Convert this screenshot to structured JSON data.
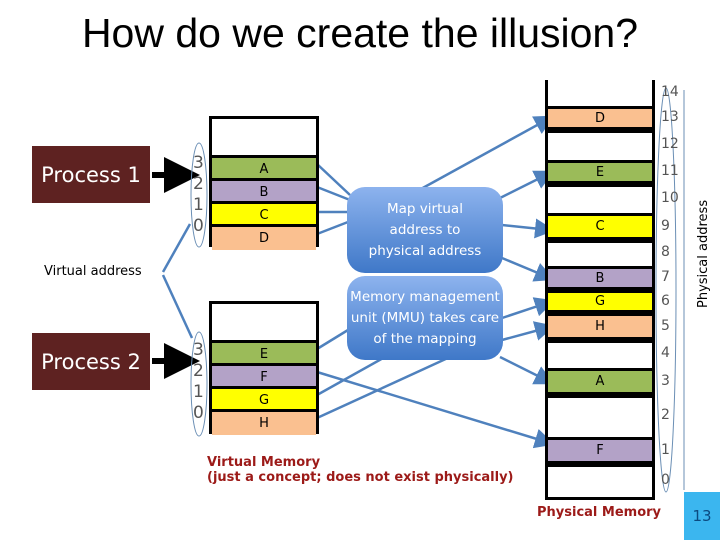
{
  "title": "How do we create the illusion?",
  "processes": [
    {
      "label": "Process 1"
    },
    {
      "label": "Process 2"
    }
  ],
  "virtual_address_label": "Virtual address",
  "virtual_addresses": [
    "3",
    "2",
    "1",
    "0"
  ],
  "virtual_memory": {
    "process1": [
      {
        "label": "",
        "color": "#ffffff"
      },
      {
        "label": "A",
        "color": "#9bbb59"
      },
      {
        "label": "B",
        "color": "#b3a2c7"
      },
      {
        "label": "C",
        "color": "#ffff00"
      },
      {
        "label": "D",
        "color": "#fac090"
      }
    ],
    "process2": [
      {
        "label": "",
        "color": "#ffffff"
      },
      {
        "label": "E",
        "color": "#9bbb59"
      },
      {
        "label": "F",
        "color": "#b3a2c7"
      },
      {
        "label": "G",
        "color": "#ffff00"
      },
      {
        "label": "H",
        "color": "#fac090"
      }
    ]
  },
  "mmu": {
    "box1": "Map virtual address to physical address",
    "box2": "Memory management unit (MMU) takes care of the mapping"
  },
  "virtual_memory_caption": {
    "line1": "Virtual Memory",
    "line2": "(just a concept; does not exist physically)"
  },
  "physical_memory": {
    "caption": "Physical Memory",
    "axis_label": "Physical address",
    "slots": [
      {
        "address": "14",
        "label": "",
        "color": "#ffffff"
      },
      {
        "address": "13",
        "label": "D",
        "color": "#fac090"
      },
      {
        "address": "12",
        "label": "",
        "color": "#ffffff"
      },
      {
        "address": "11",
        "label": "E",
        "color": "#9bbb59"
      },
      {
        "address": "10",
        "label": "",
        "color": "#ffffff"
      },
      {
        "address": "9",
        "label": "C",
        "color": "#ffff00"
      },
      {
        "address": "8",
        "label": "",
        "color": "#ffffff"
      },
      {
        "address": "7",
        "label": "B",
        "color": "#b3a2c7"
      },
      {
        "address": "6",
        "label": "G",
        "color": "#ffff00"
      },
      {
        "address": "5",
        "label": "H",
        "color": "#fac090"
      },
      {
        "address": "4",
        "label": "",
        "color": "#ffffff"
      },
      {
        "address": "3",
        "label": "A",
        "color": "#9bbb59"
      },
      {
        "address": "2",
        "label": "",
        "color": "#ffffff"
      },
      {
        "address": "1",
        "label": "F",
        "color": "#b3a2c7"
      },
      {
        "address": "0",
        "label": "",
        "color": "#ffffff"
      }
    ]
  },
  "slide_number": "13",
  "colors": {
    "process_bg": "#5e2221",
    "arrow": "#4f81bd",
    "caption_red": "#9c1a18",
    "slide_badge": "#3bb6ef"
  }
}
